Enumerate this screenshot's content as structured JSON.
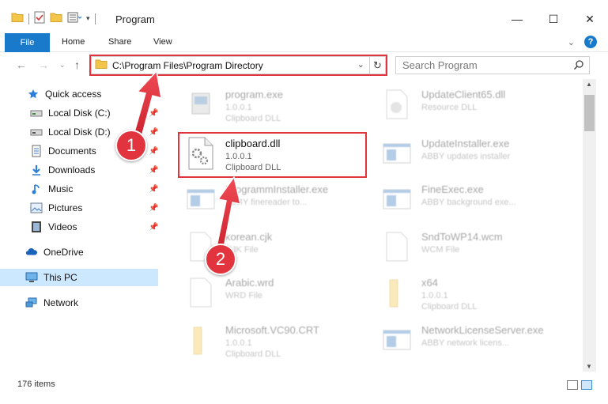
{
  "window": {
    "title": "Program",
    "controls": {
      "minimize": "—",
      "maximize": "☐",
      "close": "✕"
    }
  },
  "ribbon": {
    "tabs": [
      "File",
      "Home",
      "Share",
      "View"
    ],
    "expand_icon": "chevron-down-icon",
    "help_label": "?"
  },
  "nav": {
    "address_path": "C:\\Program Files\\Program Directory",
    "search_placeholder": "Search Program"
  },
  "sidebar": {
    "items": [
      {
        "label": "Quick access",
        "icon": "star-icon"
      },
      {
        "label": "Local Disk (C:)",
        "icon": "drive-icon",
        "pinned": true
      },
      {
        "label": "Local Disk (D:)",
        "icon": "drive-icon",
        "pinned": true
      },
      {
        "label": "Documents",
        "icon": "documents-icon",
        "pinned": true
      },
      {
        "label": "Downloads",
        "icon": "download-icon",
        "pinned": true
      },
      {
        "label": "Music",
        "icon": "music-icon",
        "pinned": true
      },
      {
        "label": "Pictures",
        "icon": "pictures-icon",
        "pinned": true
      },
      {
        "label": "Videos",
        "icon": "videos-icon",
        "pinned": true
      },
      {
        "label": "OneDrive",
        "icon": "cloud-icon"
      },
      {
        "label": "This PC",
        "icon": "computer-icon",
        "selected": true
      },
      {
        "label": "Network",
        "icon": "network-icon"
      }
    ]
  },
  "files": [
    {
      "name": "program.exe",
      "line2": "1.0.0.1",
      "line3": "Clipboard DLL",
      "icon": "exe-icon"
    },
    {
      "name": "UpdateClient65.dll",
      "line2": "Resource DLL",
      "line3": "",
      "icon": "dll-icon"
    },
    {
      "name": "clipboard.dll",
      "line2": "1.0.0.1",
      "line3": "Clipboard DLL",
      "icon": "dll-gear-icon",
      "highlighted": true
    },
    {
      "name": "UpdateInstaller.exe",
      "line2": "ABBY updates installer",
      "line3": "",
      "icon": "window-icon"
    },
    {
      "name": "ProgrammInstaller.exe",
      "line2": "ABBY finereader to...",
      "line3": "",
      "icon": "window-icon"
    },
    {
      "name": "FineExec.exe",
      "line2": "ABBY background exe...",
      "line3": "",
      "icon": "window-icon"
    },
    {
      "name": "korean.cjk",
      "line2": "CJK File",
      "line3": "",
      "icon": "file-icon"
    },
    {
      "name": "SndToWP14.wcm",
      "line2": "WCM File",
      "line3": "",
      "icon": "file-icon"
    },
    {
      "name": "Arabic.wrd",
      "line2": "WRD File",
      "line3": "",
      "icon": "file-icon"
    },
    {
      "name": "x64",
      "line2": "1.0.0.1",
      "line3": "Clipboard DLL",
      "icon": "folder-icon"
    },
    {
      "name": "Microsoft.VC90.CRT",
      "line2": "1.0.0.1",
      "line3": "Clipboard DLL",
      "icon": "folder-icon"
    },
    {
      "name": "NetworkLicenseServer.exe",
      "line2": "ABBY network licens...",
      "line3": "",
      "icon": "window-icon"
    }
  ],
  "status": {
    "item_count": "176 items"
  },
  "callouts": [
    "1",
    "2"
  ],
  "colors": {
    "accent": "#1979ca",
    "highlight": "#e1343f",
    "selection": "#cce8ff"
  }
}
